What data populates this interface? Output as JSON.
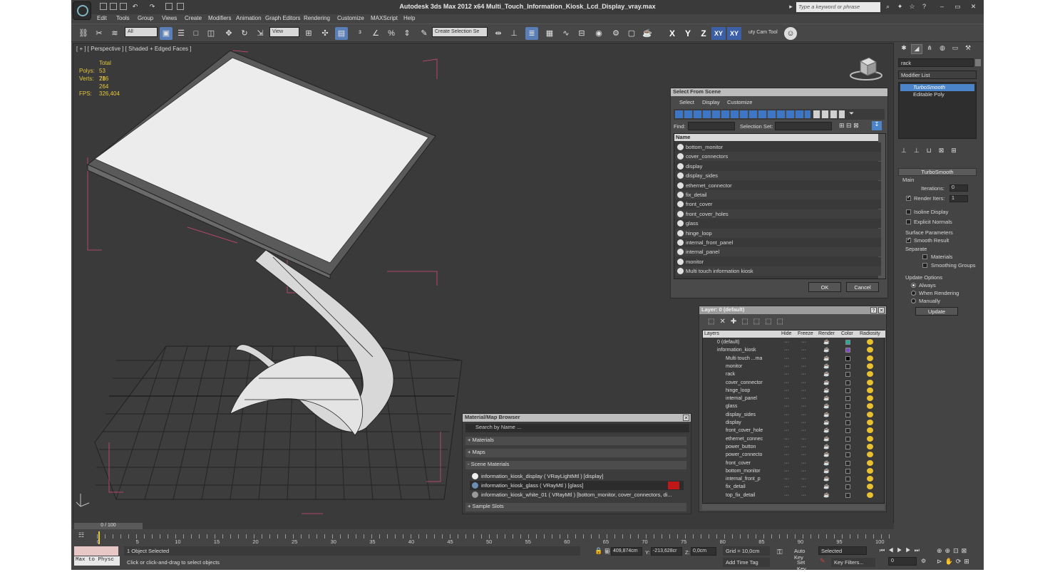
{
  "app": {
    "title": "Autodesk 3ds Max  2012 x64    Multi_Touch_Information_Kiosk_Lcd_Display_vray.max",
    "search_placeholder": "Type a keyword or phrase"
  },
  "menu": [
    "Edit",
    "Tools",
    "Group",
    "Views",
    "Create",
    "Modifiers",
    "Animation",
    "Graph Editors",
    "Rendering",
    "Customize",
    "MAXScript",
    "Help"
  ],
  "toolbar": {
    "filter": "All",
    "ref_coord": "View",
    "selection_set": "Create Selection Se",
    "cam_tool": "uty Cam Tool",
    "axes": [
      "X",
      "Y",
      "Z",
      "XY",
      "XY"
    ]
  },
  "viewport": {
    "label": "[ + ] [ Perspective ] [ Shaded + Edged Faces ]",
    "stats": {
      "total_label": "Total",
      "polys_label": "Polys:",
      "polys": "53 716",
      "verts_label": "Verts:",
      "verts": "28 264",
      "fps_label": "FPS:",
      "fps": "326,404"
    }
  },
  "select_from_scene": {
    "title": "Select From Scene",
    "menus": [
      "Select",
      "Display",
      "Customize"
    ],
    "find_label": "Find:",
    "selection_set_label": "Selection Set:",
    "column_name": "Name",
    "items": [
      "bottom_monitor",
      "cover_connectors",
      "display",
      "display_sides",
      "ethernet_connector",
      "fix_detail",
      "front_cover",
      "front_cover_holes",
      "glass",
      "hinge_loop",
      "internal_front_panel",
      "internal_panel",
      "monitor",
      "Multi touch information kiosk"
    ],
    "ok": "OK",
    "cancel": "Cancel"
  },
  "layer_dialog": {
    "title": "Layer: 0 (default)",
    "columns": [
      "Layers",
      "Hide",
      "Freeze",
      "Render",
      "Color",
      "Radiosity"
    ],
    "rows": [
      {
        "name": "0 (default)",
        "color": "#2aa89a"
      },
      {
        "name": "information_kiosk",
        "color": "#7f4ac0"
      },
      {
        "name": "Multi touch ...ma",
        "color": "#000000"
      },
      {
        "name": "monitor",
        "color": ""
      },
      {
        "name": "rack",
        "color": ""
      },
      {
        "name": "cover_connector",
        "color": ""
      },
      {
        "name": "hinge_loop",
        "color": ""
      },
      {
        "name": "internal_panel",
        "color": ""
      },
      {
        "name": "glass",
        "color": ""
      },
      {
        "name": "display_sides",
        "color": ""
      },
      {
        "name": "display",
        "color": ""
      },
      {
        "name": "front_cover_hole",
        "color": ""
      },
      {
        "name": "ethernet_connec",
        "color": ""
      },
      {
        "name": "power_button",
        "color": ""
      },
      {
        "name": "power_connecto",
        "color": ""
      },
      {
        "name": "front_cover",
        "color": ""
      },
      {
        "name": "bottom_monitor",
        "color": ""
      },
      {
        "name": "internal_front_p",
        "color": ""
      },
      {
        "name": "fix_detail",
        "color": ""
      },
      {
        "name": "top_fix_detail",
        "color": ""
      }
    ]
  },
  "material_browser": {
    "title": "Material/Map Browser",
    "search": "Search by Name ...",
    "groups": [
      "+ Materials",
      "+ Maps",
      "- Scene Materials",
      "+ Sample Slots"
    ],
    "materials": [
      "information_kiosk_display ( VRayLightMtl ) [display]",
      "information_kiosk_glass ( VRayMtl ) [glass]",
      "information_kiosk_white_01 ( VRayMtl ) [bottom_monitor, cover_connectors, di..."
    ]
  },
  "command_panel": {
    "search": "rack",
    "modifier_list": "Modifier List",
    "stack": [
      "TurboSmooth",
      "Editable Poly"
    ],
    "turbosmooth_title": "TurboSmooth",
    "main": "Main",
    "iterations_label": "Iterations:",
    "iterations": "0",
    "render_iters_label": "Render Iters:",
    "render_iters": "1",
    "isoline": "Isoline Display",
    "explicit": "Explicit Normals",
    "surface_params": "Surface Parameters",
    "smooth_result": "Smooth Result",
    "separate": "Separate",
    "materials": "Materials",
    "smoothing_groups": "Smoothing Groups",
    "update_options": "Update Options",
    "always": "Always",
    "when_rendering": "When Rendering",
    "manually": "Manually",
    "update": "Update"
  },
  "timeline": {
    "frame": "0 / 100",
    "ticks": [
      "0",
      "5",
      "10",
      "15",
      "20",
      "25",
      "30",
      "35",
      "40",
      "45",
      "50",
      "55",
      "60",
      "65",
      "70",
      "75",
      "80",
      "85",
      "90",
      "95",
      "100"
    ]
  },
  "status": {
    "maxscript": "Max to Physc",
    "selected": "1 Object Selected",
    "prompt": "Click or click-and-drag to select objects",
    "x_label": "X:",
    "x": "409,874cm",
    "y_label": "Y:",
    "y": "-213,628cr",
    "z_label": "Z:",
    "z": "0,0cm",
    "grid": "Grid = 10,0cm",
    "add_time_tag": "Add Time Tag",
    "auto_key": "Auto Key",
    "auto_key_mode": "Selected",
    "set_key": "Set Key",
    "key_filters": "Key Filters...",
    "frame": "0"
  }
}
